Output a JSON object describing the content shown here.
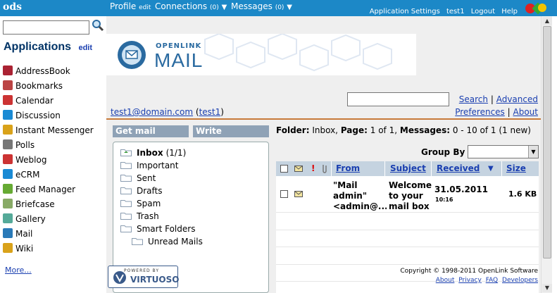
{
  "topbar": {
    "logo": "ods",
    "profile": "Profile",
    "profile_edit": "edit",
    "connections": "Connections",
    "connections_count": "(0)",
    "messages": "Messages",
    "messages_count": "(0)",
    "links": [
      "Application Settings",
      "test1",
      "Logout",
      "Help"
    ]
  },
  "sidebar": {
    "title": "Applications",
    "edit": "edit",
    "items": [
      {
        "label": "AddressBook",
        "icon": "addressbook-icon",
        "color": "#a23"
      },
      {
        "label": "Bookmarks",
        "icon": "bookmarks-icon",
        "color": "#b44"
      },
      {
        "label": "Calendar",
        "icon": "calendar-icon",
        "color": "#c33"
      },
      {
        "label": "Discussion",
        "icon": "discussion-icon",
        "color": "#1a8ad4"
      },
      {
        "label": "Instant Messenger",
        "icon": "messenger-icon",
        "color": "#d9a21a"
      },
      {
        "label": "Polls",
        "icon": "polls-icon",
        "color": "#777"
      },
      {
        "label": "Weblog",
        "icon": "weblog-icon",
        "color": "#c33"
      },
      {
        "label": "eCRM",
        "icon": "ecrm-icon",
        "color": "#1a8ad4"
      },
      {
        "label": "Feed Manager",
        "icon": "feed-icon",
        "color": "#6a3"
      },
      {
        "label": "Briefcase",
        "icon": "briefcase-icon",
        "color": "#8a6"
      },
      {
        "label": "Gallery",
        "icon": "gallery-icon",
        "color": "#5a9"
      },
      {
        "label": "Mail",
        "icon": "mail-icon",
        "color": "#2a7ab8"
      },
      {
        "label": "Wiki",
        "icon": "wiki-icon",
        "color": "#d9a21a"
      }
    ],
    "more": "More..."
  },
  "banner": {
    "line1": "OPENLINK",
    "line2": "MAIL"
  },
  "search": {
    "search_link": "Search",
    "advanced_link": "Advanced",
    "separator": "|"
  },
  "prefs": {
    "preferences": "Preferences",
    "about": "About"
  },
  "account": {
    "email": "test1@domain.com",
    "user": "test1"
  },
  "buttons": {
    "get_mail": "Get mail",
    "write": "Write"
  },
  "folders": [
    {
      "label": "Inbox",
      "count": "(1/1)",
      "bold": true
    },
    {
      "label": "Important"
    },
    {
      "label": "Sent"
    },
    {
      "label": "Drafts"
    },
    {
      "label": "Spam"
    },
    {
      "label": "Trash"
    },
    {
      "label": "Smart Folders"
    },
    {
      "label": "Unread Mails",
      "sub": true
    }
  ],
  "folder_info": {
    "folder_label": "Folder:",
    "folder": "Inbox,",
    "page_label": "Page:",
    "page": "1 of 1,",
    "messages_label": "Messages:",
    "messages": "0 - 10 of 1 (1 new)"
  },
  "groupby": {
    "label": "Group By"
  },
  "table": {
    "headers": {
      "from": "From",
      "subject": "Subject",
      "received": "Received",
      "size": "Size"
    },
    "rows": [
      {
        "from": "\"Mail admin\" <admin@...",
        "subject": "Welcome to your mail box",
        "date": "31.05.2011",
        "time": "10:16",
        "size": "1.6 KB"
      }
    ]
  },
  "footer": {
    "powered_by": "POWERED BY",
    "virtuoso": "VIRTUOSO",
    "copyright": "Copyright © 1998-2011 OpenLink Software",
    "links": [
      "About",
      "Privacy",
      "FAQ",
      "Developers"
    ]
  },
  "colors": {
    "topbar": "#1c88c7",
    "button": "#8fa2b6",
    "table_header": "#c5d3e0",
    "link": "#1a3fb0"
  }
}
